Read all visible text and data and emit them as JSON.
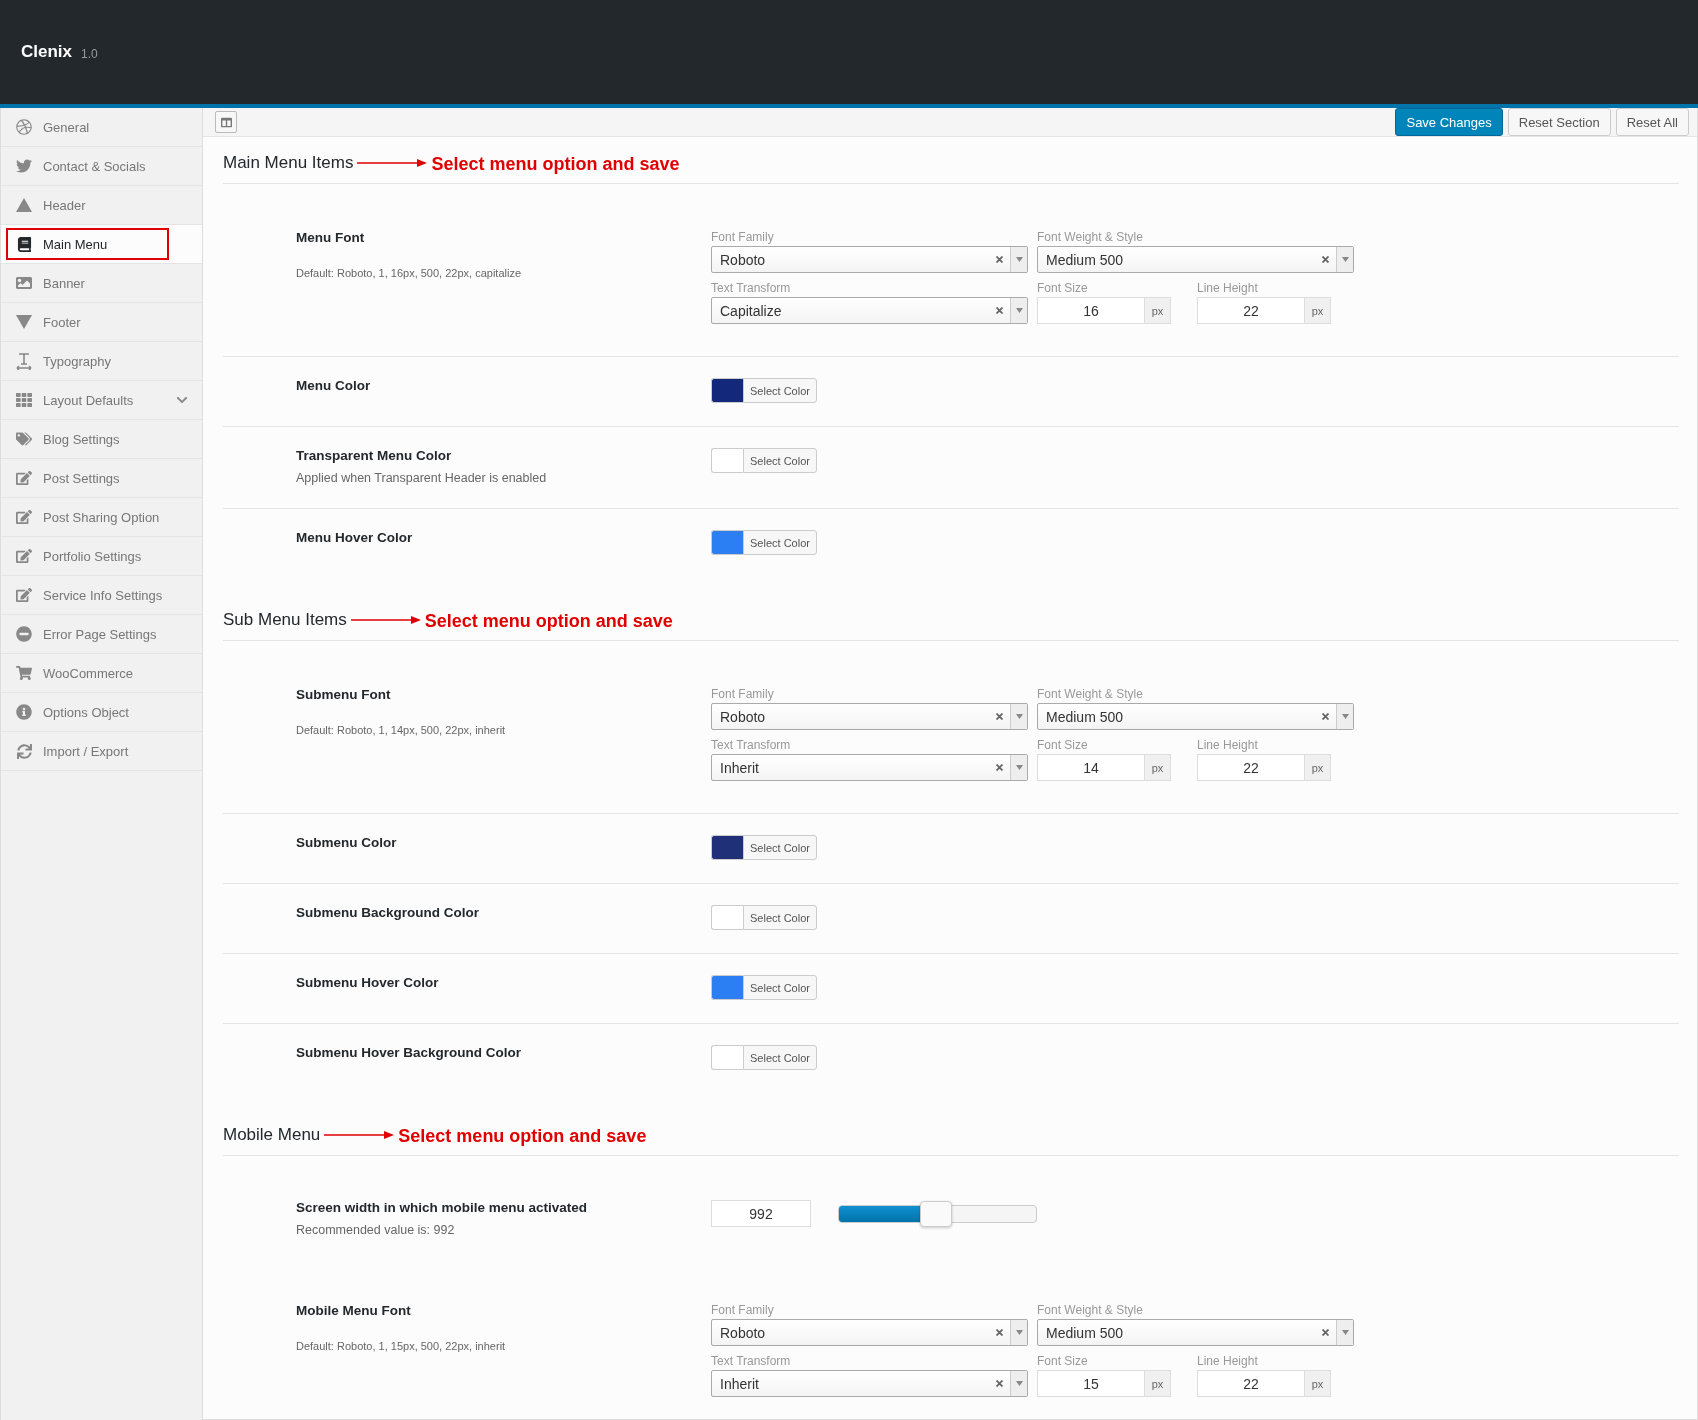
{
  "header": {
    "title": "Clenix",
    "version": "1.0"
  },
  "sidebar": {
    "items": [
      {
        "label": "General",
        "selected": false,
        "has_submenu": false
      },
      {
        "label": "Contact & Socials",
        "selected": false,
        "has_submenu": false
      },
      {
        "label": "Header",
        "selected": false,
        "has_submenu": false
      },
      {
        "label": "Main Menu",
        "selected": true,
        "has_submenu": false
      },
      {
        "label": "Banner",
        "selected": false,
        "has_submenu": false
      },
      {
        "label": "Footer",
        "selected": false,
        "has_submenu": false
      },
      {
        "label": "Typography",
        "selected": false,
        "has_submenu": false
      },
      {
        "label": "Layout Defaults",
        "selected": false,
        "has_submenu": true
      },
      {
        "label": "Blog Settings",
        "selected": false,
        "has_submenu": false
      },
      {
        "label": "Post Settings",
        "selected": false,
        "has_submenu": false
      },
      {
        "label": "Post Sharing Option",
        "selected": false,
        "has_submenu": false
      },
      {
        "label": "Portfolio Settings",
        "selected": false,
        "has_submenu": false
      },
      {
        "label": "Service Info Settings",
        "selected": false,
        "has_submenu": false
      },
      {
        "label": "Error Page Settings",
        "selected": false,
        "has_submenu": false
      },
      {
        "label": "WooCommerce",
        "selected": false,
        "has_submenu": false
      },
      {
        "label": "Options Object",
        "selected": false,
        "has_submenu": false
      },
      {
        "label": "Import / Export",
        "selected": false,
        "has_submenu": false
      }
    ]
  },
  "toolbar": {
    "buttons": [
      {
        "label": "Save Changes",
        "primary": true
      },
      {
        "label": "Reset Section",
        "primary": false
      },
      {
        "label": "Reset All",
        "primary": false
      }
    ]
  },
  "sections": [
    {
      "title": "Main Menu Items",
      "annotation": "Select menu option and save",
      "rows": [
        {
          "kind": "font",
          "label": "Menu Font",
          "description": "Default: Roboto, 1, 16px, 500, 22px, capitalize",
          "font_family": {
            "label": "Font Family",
            "value": "Roboto"
          },
          "font_weight": {
            "label": "Font Weight & Style",
            "value": "Medium 500"
          },
          "text_transform": {
            "label": "Text Transform",
            "value": "Capitalize"
          },
          "font_size": {
            "label": "Font Size",
            "value": "16",
            "unit": "px"
          },
          "line_height": {
            "label": "Line Height",
            "value": "22",
            "unit": "px"
          }
        },
        {
          "kind": "color",
          "label": "Menu Color",
          "color": "#13287a",
          "button": "Select Color"
        },
        {
          "kind": "color",
          "label": "Transparent Menu Color",
          "description": "Applied when Transparent Header is enabled",
          "color": "#ffffff",
          "button": "Select Color"
        },
        {
          "kind": "color",
          "label": "Menu Hover Color",
          "color": "#2b7ff2",
          "button": "Select Color"
        }
      ]
    },
    {
      "title": "Sub Menu Items",
      "annotation": "Select menu option and save",
      "rows": [
        {
          "kind": "font",
          "label": "Submenu Font",
          "description": "Default: Roboto, 1, 14px, 500, 22px, inherit",
          "font_family": {
            "label": "Font Family",
            "value": "Roboto"
          },
          "font_weight": {
            "label": "Font Weight & Style",
            "value": "Medium 500"
          },
          "text_transform": {
            "label": "Text Transform",
            "value": "Inherit"
          },
          "font_size": {
            "label": "Font Size",
            "value": "14",
            "unit": "px"
          },
          "line_height": {
            "label": "Line Height",
            "value": "22",
            "unit": "px"
          }
        },
        {
          "kind": "color",
          "label": "Submenu Color",
          "color": "#1f3078",
          "button": "Select Color"
        },
        {
          "kind": "color",
          "label": "Submenu Background Color",
          "color": "#ffffff",
          "button": "Select Color"
        },
        {
          "kind": "color",
          "label": "Submenu Hover Color",
          "color": "#2b7ff2",
          "button": "Select Color"
        },
        {
          "kind": "color",
          "label": "Submenu Hover Background Color",
          "color": "#ffffff",
          "button": "Select Color"
        }
      ]
    },
    {
      "title": "Mobile Menu",
      "annotation": "Select menu option and save",
      "rows": [
        {
          "kind": "slider",
          "label": "Screen width in which mobile menu activated",
          "description": "Recommended value is: 992",
          "value": "992",
          "level": 0.49
        },
        {
          "kind": "font",
          "label": "Mobile Menu Font",
          "description": "Default: Roboto, 1, 15px, 500, 22px, inherit",
          "font_family": {
            "label": "Font Family",
            "value": "Roboto"
          },
          "font_weight": {
            "label": "Font Weight & Style",
            "value": "Medium 500"
          },
          "text_transform": {
            "label": "Text Transform",
            "value": "Inherit"
          },
          "font_size": {
            "label": "Font Size",
            "value": "15",
            "unit": "px"
          },
          "line_height": {
            "label": "Line Height",
            "value": "22",
            "unit": "px"
          }
        }
      ]
    }
  ]
}
